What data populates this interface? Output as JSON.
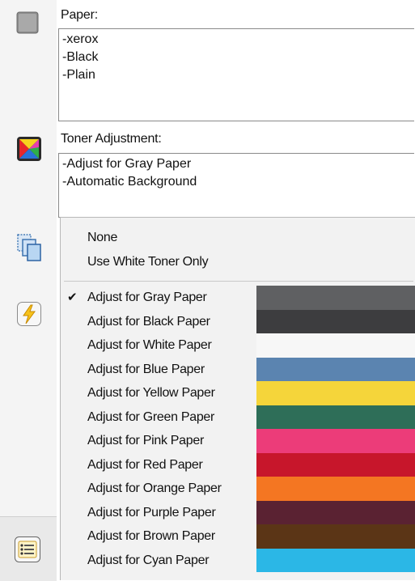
{
  "paper": {
    "label": "Paper:",
    "lines": [
      "-xerox",
      "-Black",
      "-Plain"
    ]
  },
  "toner": {
    "label": "Toner Adjustment:",
    "lines": [
      "-Adjust for Gray Paper",
      "-Automatic Background"
    ]
  },
  "menu": {
    "top_items": [
      "None",
      "Use White Toner Only"
    ],
    "check_mark": "✔",
    "items": [
      {
        "label": "Adjust for Gray Paper",
        "checked": true,
        "color": "#5f6062"
      },
      {
        "label": "Adjust for Black Paper",
        "checked": false,
        "color": "#3d3d3f"
      },
      {
        "label": "Adjust for White Paper",
        "checked": false,
        "color": "#f7f7f7"
      },
      {
        "label": "Adjust for Blue Paper",
        "checked": false,
        "color": "#5b84b0"
      },
      {
        "label": "Adjust for Yellow Paper",
        "checked": false,
        "color": "#f5d53a"
      },
      {
        "label": "Adjust for Green Paper",
        "checked": false,
        "color": "#2e6e58"
      },
      {
        "label": "Adjust for Pink Paper",
        "checked": false,
        "color": "#ec3c79"
      },
      {
        "label": "Adjust for Red Paper",
        "checked": false,
        "color": "#c7162b"
      },
      {
        "label": "Adjust for Orange Paper",
        "checked": false,
        "color": "#f47622"
      },
      {
        "label": "Adjust for Purple Paper",
        "checked": false,
        "color": "#5a2232"
      },
      {
        "label": "Adjust for Brown Paper",
        "checked": false,
        "color": "#5b3516"
      },
      {
        "label": "Adjust for Cyan Paper",
        "checked": false,
        "color": "#2bb7e6"
      }
    ]
  },
  "icons": [
    "paper-icon",
    "toner-color-icon",
    "copy-pages-icon",
    "lightning-icon",
    "list-settings-icon"
  ]
}
